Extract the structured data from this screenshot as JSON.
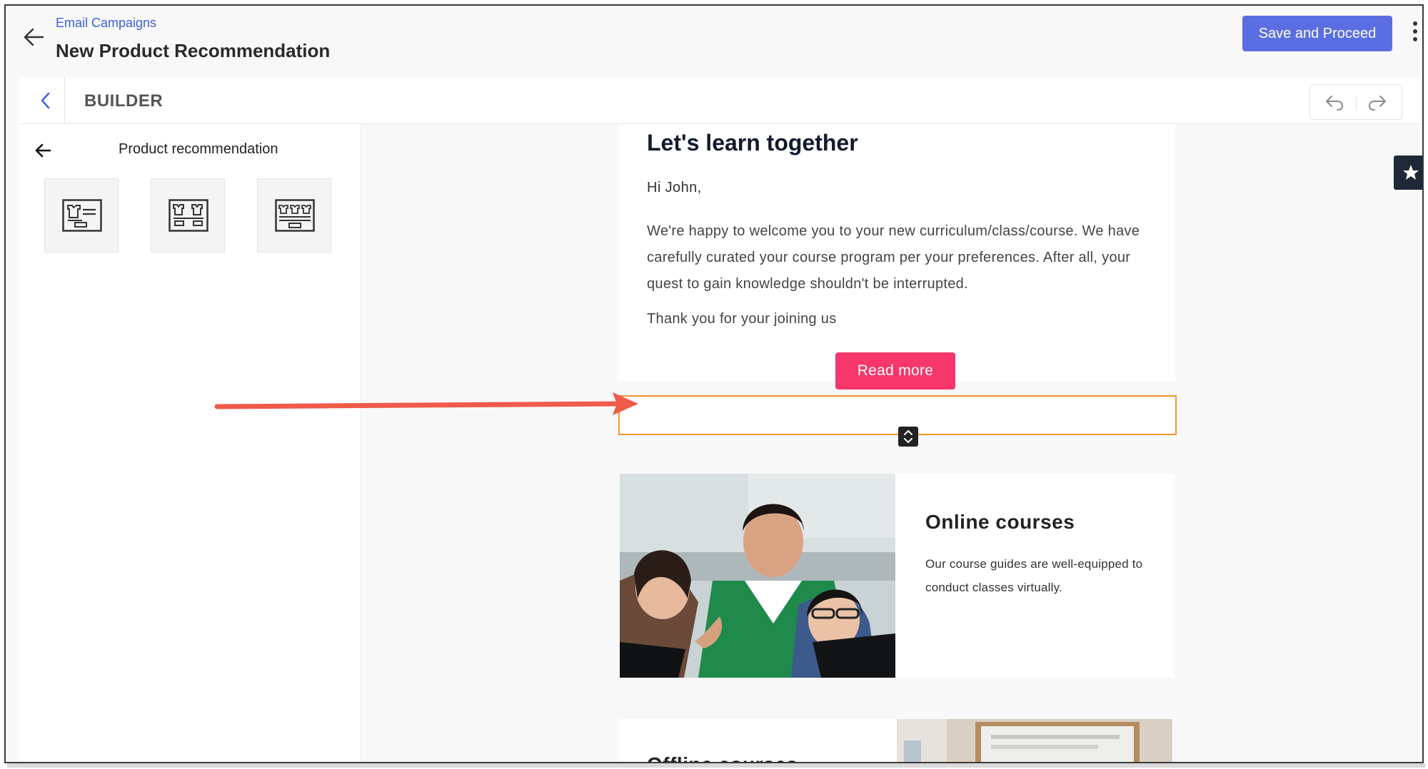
{
  "header": {
    "breadcrumb": "Email Campaigns",
    "title": "New Product Recommendation",
    "save_button": "Save and Proceed"
  },
  "builder": {
    "label": "BUILDER"
  },
  "panel": {
    "title": "Product recommendation",
    "layouts": [
      "one-product-layout-icon",
      "two-product-layout-icon",
      "three-product-layout-icon"
    ]
  },
  "email": {
    "heading": "Let's learn together",
    "greeting": "Hi John,",
    "body": "We're happy to welcome you to your new curriculum/class/course. We have carefully curated your course program per your preferences. After all, your quest to gain knowledge shouldn't be interrupted.",
    "thanks": "Thank you for your joining us",
    "cta": "Read more",
    "courses": [
      {
        "title": "Online courses",
        "description": "Our course guides are well-equipped to conduct classes virtually."
      },
      {
        "title": "Offline courses",
        "description": ""
      }
    ]
  },
  "colors": {
    "primary": "#5b6ee1",
    "cta": "#f7366b",
    "selection": "#f0962c",
    "annotation_arrow": "#ef5a4a",
    "link": "#3f5fd8"
  }
}
